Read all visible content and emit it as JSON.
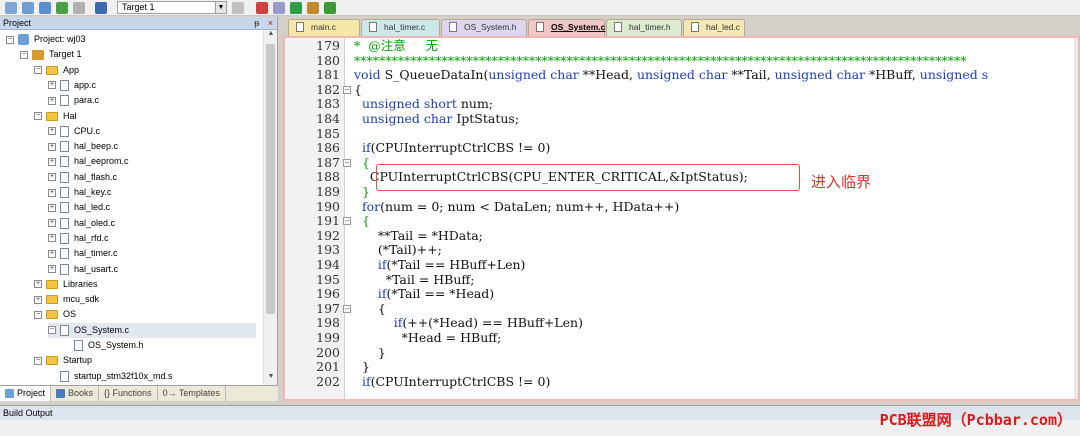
{
  "toolbar": {
    "target_select": "Target 1"
  },
  "project": {
    "title": "Project",
    "pin": "ᵽ",
    "close": "×",
    "tree": [
      {
        "label": "Project: wj03",
        "level": 0,
        "kind": "project",
        "toggle": "−"
      },
      {
        "label": "Target 1",
        "level": 1,
        "kind": "target",
        "toggle": "−"
      },
      {
        "label": "App",
        "level": 2,
        "kind": "folder",
        "toggle": "−"
      },
      {
        "label": "app.c",
        "level": 3,
        "kind": "file",
        "toggle": "+"
      },
      {
        "label": "para.c",
        "level": 3,
        "kind": "file",
        "toggle": "+"
      },
      {
        "label": "Hal",
        "level": 2,
        "kind": "folder",
        "toggle": "−"
      },
      {
        "label": "CPU.c",
        "level": 3,
        "kind": "file",
        "toggle": "+"
      },
      {
        "label": "hal_beep.c",
        "level": 3,
        "kind": "file",
        "toggle": "+"
      },
      {
        "label": "hal_eeprom.c",
        "level": 3,
        "kind": "file",
        "toggle": "+"
      },
      {
        "label": "hal_flash.c",
        "level": 3,
        "kind": "file",
        "toggle": "+"
      },
      {
        "label": "hal_key.c",
        "level": 3,
        "kind": "file",
        "toggle": "+"
      },
      {
        "label": "hal_led.c",
        "level": 3,
        "kind": "file",
        "toggle": "+"
      },
      {
        "label": "hal_oled.c",
        "level": 3,
        "kind": "file",
        "toggle": "+"
      },
      {
        "label": "hal_rfd.c",
        "level": 3,
        "kind": "file",
        "toggle": "+"
      },
      {
        "label": "hal_timer.c",
        "level": 3,
        "kind": "file",
        "toggle": "+"
      },
      {
        "label": "hal_usart.c",
        "level": 3,
        "kind": "file",
        "toggle": "+"
      },
      {
        "label": "Libraries",
        "level": 2,
        "kind": "folder",
        "toggle": "+"
      },
      {
        "label": "mcu_sdk",
        "level": 2,
        "kind": "folder",
        "toggle": "+"
      },
      {
        "label": "OS",
        "level": 2,
        "kind": "folder",
        "toggle": "−"
      },
      {
        "label": "OS_System.c",
        "level": 3,
        "kind": "file",
        "toggle": "−",
        "selected": true
      },
      {
        "label": "OS_System.h",
        "level": 4,
        "kind": "file",
        "toggle": ""
      },
      {
        "label": "Startup",
        "level": 2,
        "kind": "folder",
        "toggle": "−"
      },
      {
        "label": "startup_stm32f10x_md.s",
        "level": 3,
        "kind": "file",
        "toggle": ""
      }
    ],
    "tabs": [
      "Project",
      "Books",
      "{} Functions",
      "0→ Templates"
    ]
  },
  "editor": {
    "tabs": [
      {
        "label": "main.c",
        "color": "#f5e7a8"
      },
      {
        "label": "hal_timer.c",
        "color": "#cde8e8"
      },
      {
        "label": "OS_System.h",
        "color": "#ddd6ee"
      },
      {
        "label": "OS_System.c",
        "color": "#f3c6c6",
        "active": true
      },
      {
        "label": "hal_timer.h",
        "color": "#dcead0"
      },
      {
        "label": "hal_led.c",
        "color": "#f4e9b4"
      }
    ],
    "lines": [
      {
        "n": "179",
        "fold": "",
        "parts": [
          [
            "cm",
            "*  @注意     无"
          ]
        ]
      },
      {
        "n": "180",
        "fold": "",
        "parts": [
          [
            "cm",
            "**************************************************************************************************"
          ]
        ]
      },
      {
        "n": "181",
        "fold": "",
        "parts": [
          [
            "kw",
            "void"
          ],
          [
            "",
            " S_QueueDataIn("
          ],
          [
            "kw",
            "unsigned char"
          ],
          [
            "",
            " **Head, "
          ],
          [
            "kw",
            "unsigned char"
          ],
          [
            "",
            " **Tail, "
          ],
          [
            "kw",
            "unsigned char"
          ],
          [
            "",
            " *HBuff, "
          ],
          [
            "kw",
            "unsigned s"
          ]
        ]
      },
      {
        "n": "182",
        "fold": "−",
        "parts": [
          [
            "",
            "{"
          ]
        ]
      },
      {
        "n": "183",
        "fold": "",
        "parts": [
          [
            "kw",
            "  unsigned short"
          ],
          [
            "",
            " num;"
          ]
        ]
      },
      {
        "n": "184",
        "fold": "",
        "parts": [
          [
            "kw",
            "  unsigned char"
          ],
          [
            "",
            " IptStatus;"
          ]
        ]
      },
      {
        "n": "185",
        "fold": "",
        "parts": [
          [
            "",
            ""
          ]
        ]
      },
      {
        "n": "186",
        "fold": "",
        "parts": [
          [
            "kw",
            "  if"
          ],
          [
            "",
            "(CPUInterruptCtrlCBS != 0)"
          ]
        ]
      },
      {
        "n": "187",
        "fold": "−",
        "parts": [
          [
            "cm",
            "  {"
          ]
        ]
      },
      {
        "n": "188",
        "fold": "",
        "parts": [
          [
            "",
            "    CPUInterruptCtrlCBS(CPU_ENTER_CRITICAL,&IptStatus);"
          ]
        ]
      },
      {
        "n": "189",
        "fold": "",
        "parts": [
          [
            "cm",
            "  }"
          ]
        ]
      },
      {
        "n": "190",
        "fold": "",
        "parts": [
          [
            "kw",
            "  for"
          ],
          [
            "",
            "(num = 0; num < DataLen; num++, HData++)"
          ]
        ]
      },
      {
        "n": "191",
        "fold": "−",
        "parts": [
          [
            "cm",
            "  {"
          ]
        ]
      },
      {
        "n": "192",
        "fold": "",
        "parts": [
          [
            "",
            "      **Tail = *HData;"
          ]
        ]
      },
      {
        "n": "193",
        "fold": "",
        "parts": [
          [
            "",
            "      (*Tail)++;"
          ]
        ]
      },
      {
        "n": "194",
        "fold": "",
        "parts": [
          [
            "kw",
            "      if"
          ],
          [
            "",
            "(*Tail == HBuff+Len)"
          ]
        ]
      },
      {
        "n": "195",
        "fold": "",
        "parts": [
          [
            "",
            "        *Tail = HBuff;"
          ]
        ]
      },
      {
        "n": "196",
        "fold": "",
        "parts": [
          [
            "kw",
            "      if"
          ],
          [
            "",
            "(*Tail == *Head)"
          ]
        ]
      },
      {
        "n": "197",
        "fold": "−",
        "parts": [
          [
            "",
            "      {"
          ]
        ]
      },
      {
        "n": "198",
        "fold": "",
        "parts": [
          [
            "kw",
            "          if"
          ],
          [
            "",
            "(++(*Head) == HBuff+Len)"
          ]
        ]
      },
      {
        "n": "199",
        "fold": "",
        "parts": [
          [
            "",
            "            *Head = HBuff;"
          ]
        ]
      },
      {
        "n": "200",
        "fold": "",
        "parts": [
          [
            "",
            "      }"
          ]
        ]
      },
      {
        "n": "201",
        "fold": "",
        "parts": [
          [
            "",
            "  }"
          ]
        ]
      },
      {
        "n": "202",
        "fold": "",
        "parts": [
          [
            "kw",
            "  if"
          ],
          [
            "",
            "(CPUInterruptCtrlCBS != 0)"
          ]
        ]
      }
    ],
    "callout_text": "进入临界"
  },
  "build_output": {
    "title": "Build Output"
  },
  "watermark": "PCB联盟网（Pcbbar.com）"
}
